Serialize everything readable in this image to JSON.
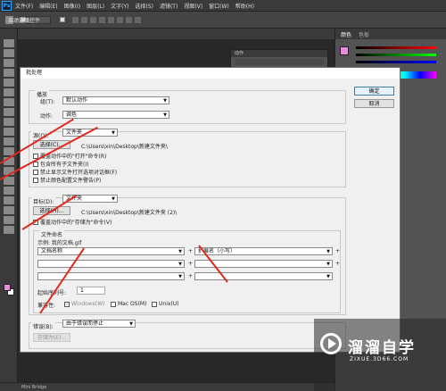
{
  "app": {
    "logo": "Ps"
  },
  "menubar": [
    "文件(F)",
    "编辑(E)",
    "图像(I)",
    "图层(L)",
    "文字(Y)",
    "选择(S)",
    "滤镜(T)",
    "视图(V)",
    "窗口(W)",
    "帮助(H)"
  ],
  "optionsbar": {
    "auto_select": "自动选择：",
    "show_transform": "显示变换控件"
  },
  "right_panel": {
    "tab_color": "颜色",
    "tab_swatches": "色板",
    "sub_panel_tab": "动作"
  },
  "bottom": {
    "mini_bridge": "Mini Bridge"
  },
  "dialog": {
    "title": "批处理",
    "play": {
      "group_title": "播放",
      "set_label": "组(T):",
      "set_value": "默认动作",
      "action_label": "动作:",
      "action_value": "调色"
    },
    "source": {
      "label": "源(O):",
      "value": "文件夹",
      "choose": "选择(C)...",
      "path": "C:\\Users\\xin\\Desktop\\新建文件夹\\",
      "options": [
        "覆盖动作中的\"打开\"命令(R)",
        "包含所有子文件夹(I)",
        "禁止显示文件打开选项对话框(F)",
        "禁止颜色配置文件警告(P)"
      ]
    },
    "destination": {
      "label": "目标(D):",
      "value": "文件夹",
      "choose": "选择(H)...",
      "path": "C:\\Users\\xin\\Desktop\\新建文件夹 (2)\\",
      "override_save": "覆盖动作中的\"存储为\"命令(V)",
      "naming_group": "文件命名",
      "example": "示例: 我的文档.gif",
      "name_1": "文档名称",
      "name_2": "扩展名（小写）",
      "serial_label": "起始序列号:",
      "serial_value": "1",
      "compat_label": "兼容性:",
      "compat": [
        "Windows(W)",
        "Mac OS(M)",
        "Unix(U)"
      ]
    },
    "errors": {
      "label": "错误(B):",
      "value": "由于错误而停止",
      "save_as": "存储为(E)..."
    },
    "buttons": {
      "ok": "确定",
      "cancel": "取消"
    }
  },
  "watermark": {
    "brand": "溜溜自学",
    "url": "ZIXUE.3D66.COM"
  },
  "colors": {
    "annotation": "#e0281e",
    "foreground": "#e88cd8"
  }
}
